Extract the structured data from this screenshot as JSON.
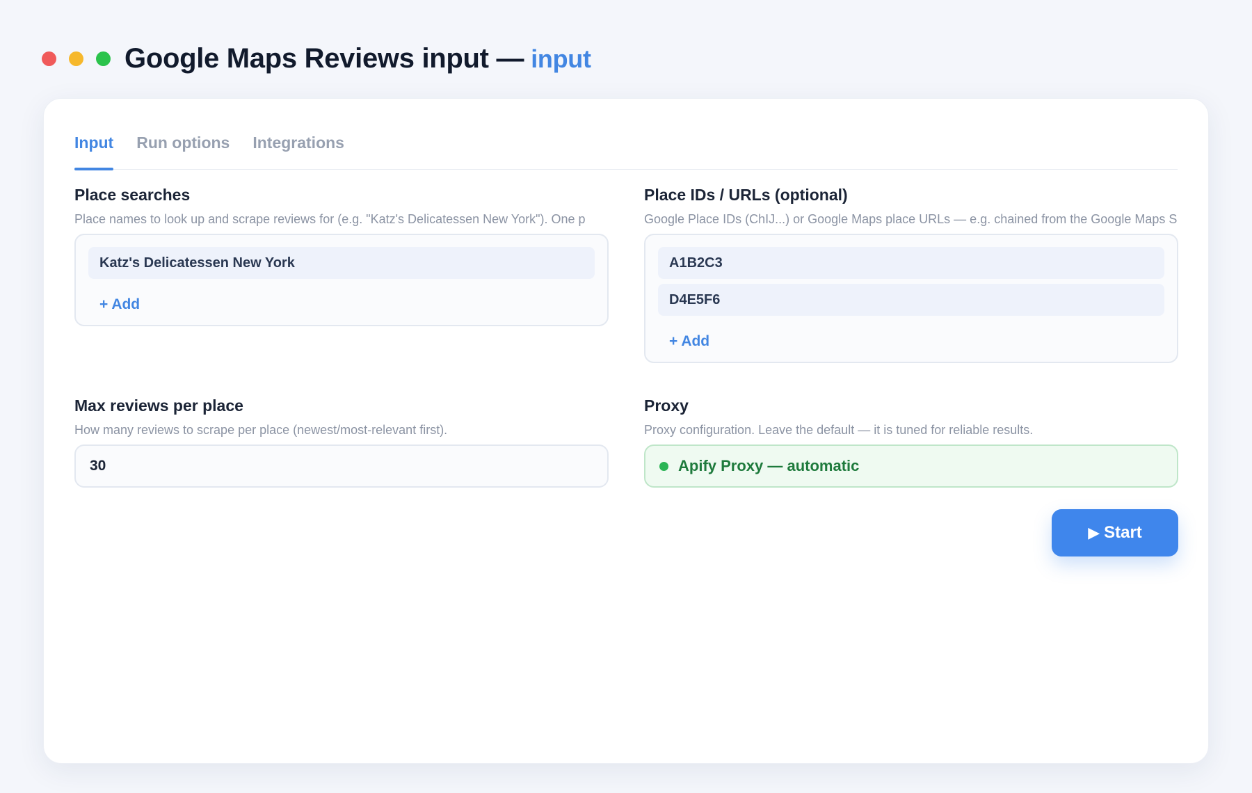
{
  "window": {
    "title": "Google Maps Reviews input —",
    "title_accent": "input"
  },
  "tabs": [
    {
      "label": "Input",
      "active": true
    },
    {
      "label": "Run options",
      "active": false
    },
    {
      "label": "Integrations",
      "active": false
    }
  ],
  "place_searches": {
    "title": "Place searches",
    "help": "Place names to look up and scrape reviews for (e.g. \"Katz's Delicatessen New York\"). One p",
    "items": [
      "Katz's Delicatessen New York"
    ],
    "add_label": "+ Add"
  },
  "place_ids": {
    "title": "Place IDs / URLs (optional)",
    "help": "Google Place IDs (ChIJ...) or Google Maps place URLs — e.g. chained from the Google Maps S",
    "items": [
      "A1B2C3",
      "D4E5F6"
    ],
    "add_label": "+ Add"
  },
  "max_reviews": {
    "title": "Max reviews per place",
    "help": "How many reviews to scrape per place (newest/most-relevant first).",
    "value": "30"
  },
  "proxy": {
    "title": "Proxy",
    "help": "Proxy configuration. Leave the default — it is tuned for reliable results.",
    "value": "Apify Proxy — automatic",
    "status_color": "#2bb455"
  },
  "actions": {
    "start_icon": "▶",
    "start_label": "Start"
  },
  "colors": {
    "accent": "#4286e2",
    "button": "#3f86ec"
  }
}
